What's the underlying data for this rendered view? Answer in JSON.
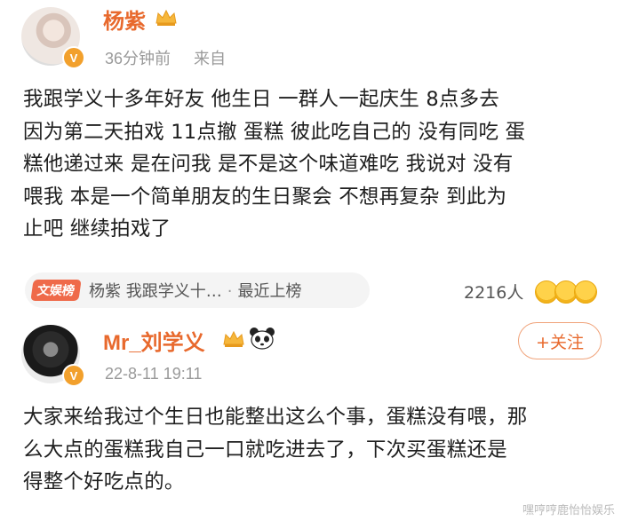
{
  "post1": {
    "author": "杨紫",
    "verified_badge": "V",
    "time": "36分钟前",
    "source": "来自",
    "lines": [
      "我跟学义十多年好友 他生日 一群人一起庆生 8点多去",
      "因为第二天拍戏 11点撤 蛋糕 彼此吃自己的 没有同吃 蛋",
      "糕他递过来 是在问我 是不是这个味道难吃 我说对 没有",
      "喂我 本是一个简单朋友的生日聚会 不想再复杂 到此为",
      "止吧 继续拍戏了"
    ]
  },
  "hot_tag": {
    "badge": "文娱榜",
    "text": "杨紫 我跟学义十…",
    "separator": "·",
    "status": "最近上榜"
  },
  "reactions": {
    "count": "2216人"
  },
  "post2": {
    "author": "Mr_刘学义",
    "verified_badge": "V",
    "time": "22-8-11 19:11",
    "follow_label": "+关注",
    "lines": [
      "大家来给我过个生日也能整出这么个事，蛋糕没有喂，那",
      "么大点的蛋糕我自己一口就吃进去了，下次买蛋糕还是",
      "得整个好吃点的。"
    ]
  },
  "watermark": "嘿哼哼鹿怡怡娱乐",
  "colors": {
    "accent": "#e8692d",
    "tag": "#ef6a4a",
    "verified": "#f2a02c"
  }
}
